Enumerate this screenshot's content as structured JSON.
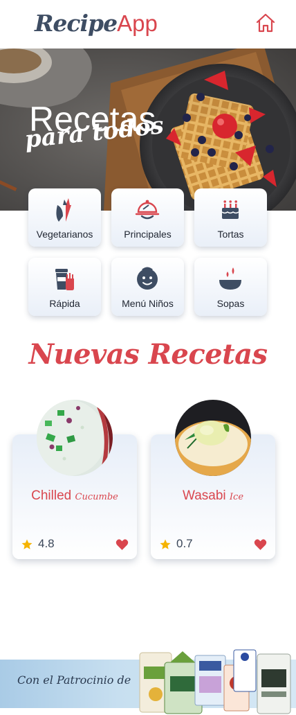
{
  "app": {
    "logo_part1": "Recipe",
    "logo_part2": "App"
  },
  "hero": {
    "title_line1": "Recetas",
    "title_line2": "para todos"
  },
  "categories": [
    {
      "label": "Vegetarianos",
      "icon": "carrot-icon"
    },
    {
      "label": "Principales",
      "icon": "serving-dish-icon"
    },
    {
      "label": "Tortas",
      "icon": "cake-icon"
    },
    {
      "label": "Rápida",
      "icon": "fast-food-icon"
    },
    {
      "label": "Menú Niños",
      "icon": "child-face-icon"
    },
    {
      "label": "Sopas",
      "icon": "soup-bowl-icon"
    }
  ],
  "section": {
    "title": "Nuevas Recetas"
  },
  "recipes": [
    {
      "name": "Chilled",
      "name_sub": "Cucumbe",
      "rating": "4.8"
    },
    {
      "name": "Wasabi",
      "name_sub": "Ice",
      "rating": "0.7"
    }
  ],
  "sponsor": {
    "text": "Con el Patrocinio de"
  },
  "colors": {
    "accent": "#d9464e",
    "dark": "#3e4d63",
    "star": "#f5b301"
  }
}
